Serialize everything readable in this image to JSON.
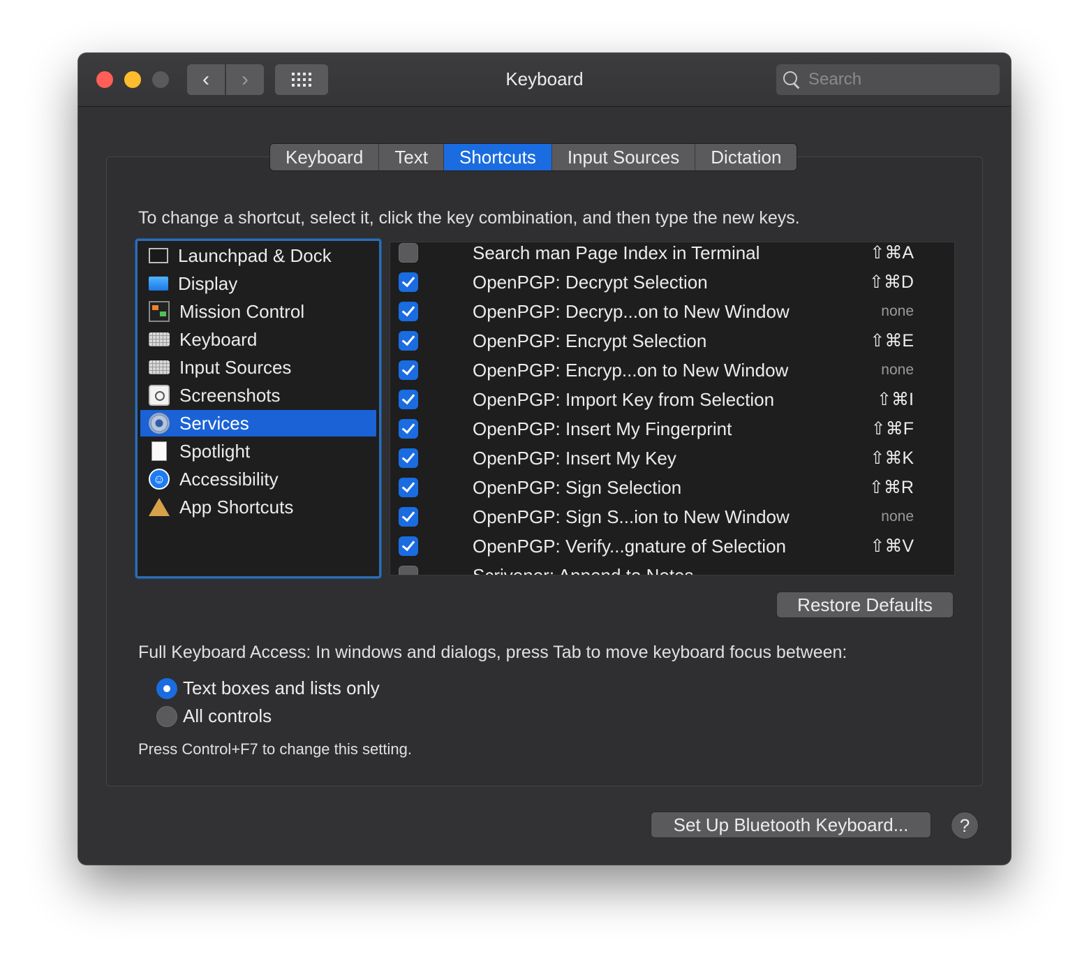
{
  "window": {
    "title": "Keyboard"
  },
  "toolbar": {
    "search_placeholder": "Search"
  },
  "tabs": [
    {
      "label": "Keyboard",
      "active": false
    },
    {
      "label": "Text",
      "active": false
    },
    {
      "label": "Shortcuts",
      "active": true
    },
    {
      "label": "Input Sources",
      "active": false
    },
    {
      "label": "Dictation",
      "active": false
    }
  ],
  "instruction": "To change a shortcut, select it, click the key combination, and then type the new keys.",
  "categories": [
    {
      "label": "Launchpad & Dock",
      "icon": "dock-icon"
    },
    {
      "label": "Display",
      "icon": "display-icon"
    },
    {
      "label": "Mission Control",
      "icon": "mission-control-icon"
    },
    {
      "label": "Keyboard",
      "icon": "keyboard-icon"
    },
    {
      "label": "Input Sources",
      "icon": "keyboard-icon"
    },
    {
      "label": "Screenshots",
      "icon": "screenshot-icon"
    },
    {
      "label": "Services",
      "icon": "gear-icon",
      "selected": true
    },
    {
      "label": "Spotlight",
      "icon": "document-icon"
    },
    {
      "label": "Accessibility",
      "icon": "accessibility-icon"
    },
    {
      "label": "App Shortcuts",
      "icon": "app-store-icon"
    }
  ],
  "shortcuts": [
    {
      "name": "Search man Page Index in Terminal",
      "key": "⇧⌘A",
      "checked": false
    },
    {
      "name": "OpenPGP: Decrypt Selection",
      "key": "⇧⌘D",
      "checked": true
    },
    {
      "name": "OpenPGP: Decryp...on to New Window",
      "key": "none",
      "checked": true
    },
    {
      "name": "OpenPGP: Encrypt Selection",
      "key": "⇧⌘E",
      "checked": true
    },
    {
      "name": "OpenPGP: Encryp...on to New Window",
      "key": "none",
      "checked": true
    },
    {
      "name": "OpenPGP: Import Key from Selection",
      "key": "⇧⌘I",
      "checked": true
    },
    {
      "name": "OpenPGP: Insert My Fingerprint",
      "key": "⇧⌘F",
      "checked": true
    },
    {
      "name": "OpenPGP: Insert My Key",
      "key": "⇧⌘K",
      "checked": true
    },
    {
      "name": "OpenPGP: Sign Selection",
      "key": "⇧⌘R",
      "checked": true
    },
    {
      "name": "OpenPGP: Sign S...ion to New Window",
      "key": "none",
      "checked": true
    },
    {
      "name": "OpenPGP: Verify...gnature of Selection",
      "key": "⇧⌘V",
      "checked": true
    },
    {
      "name": "Scrivener: Append to Notes",
      "key": "",
      "checked": false
    }
  ],
  "restore_label": "Restore Defaults",
  "full_keyboard_access": {
    "label": "Full Keyboard Access: In windows and dialogs, press Tab to move keyboard focus between:",
    "options": [
      {
        "label": "Text boxes and lists only",
        "selected": true
      },
      {
        "label": "All controls",
        "selected": false
      }
    ],
    "hint": "Press Control+F7 to change this setting."
  },
  "bluetooth_label": "Set Up Bluetooth Keyboard...",
  "help_label": "?"
}
